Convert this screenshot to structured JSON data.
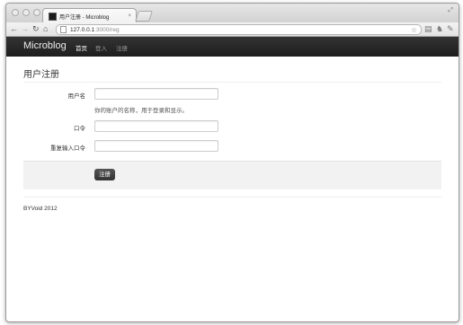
{
  "browser": {
    "tab_title": "用户注册 - Microblog",
    "tab_close": "×",
    "url_host": "127.0.0.1",
    "url_rest": ":3000/reg"
  },
  "navbar": {
    "brand": "Microblog",
    "items": [
      {
        "label": "首页",
        "active": true
      },
      {
        "label": "登入",
        "active": false
      },
      {
        "label": "注册",
        "active": false
      }
    ]
  },
  "page": {
    "title": "用户注册"
  },
  "form": {
    "username": {
      "label": "用户名",
      "value": "",
      "help": "你的账户的名称，用于登录和显示。"
    },
    "password": {
      "label": "口令",
      "value": ""
    },
    "password_repeat": {
      "label": "重复输入口令",
      "value": ""
    },
    "submit_label": "注册"
  },
  "footer": {
    "text": "BYVoid 2012"
  }
}
